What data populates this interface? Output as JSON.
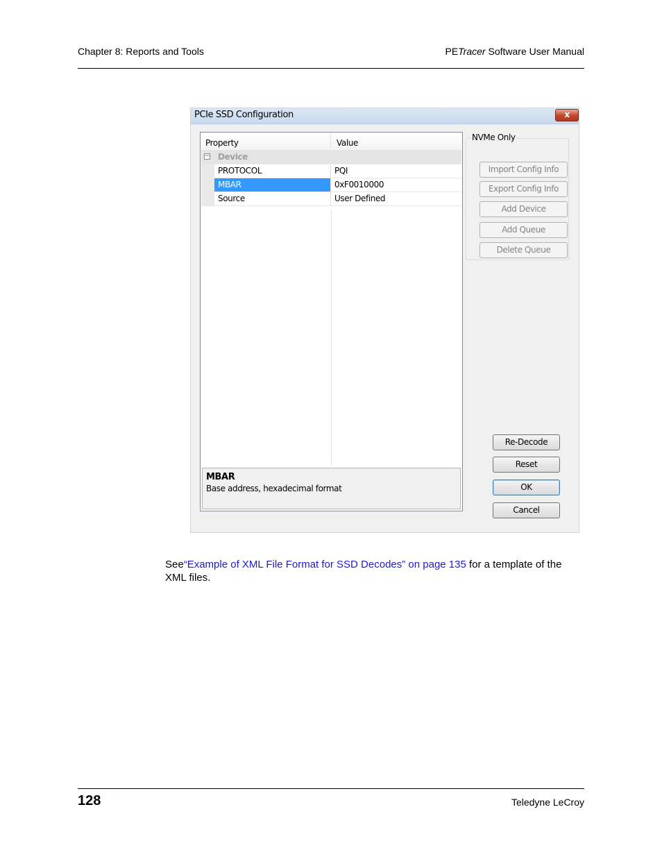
{
  "header": {
    "chapter": "Chapter 8: Reports and Tools",
    "manual_prefix": "PE",
    "manual_italic": "Tracer",
    "manual_suffix": " Software User Manual"
  },
  "dialog": {
    "title": "PCIe SSD Configuration",
    "close_glyph": "x",
    "grid": {
      "col_property": "Property",
      "col_value": "Value",
      "category": "Device",
      "expander_glyph": "−",
      "rows": [
        {
          "property": "PROTOCOL",
          "value": "PQI"
        },
        {
          "property": "MBAR",
          "value": "0xF0010000"
        },
        {
          "property": "Source",
          "value": "User Defined"
        }
      ],
      "selected_row": "MBAR"
    },
    "description": {
      "name": "MBAR",
      "text": "Base address, hexadecimal format"
    },
    "nvme_group": {
      "label": "NVMe Only",
      "buttons": {
        "import": "Import Config Info",
        "export": "Export Config Info",
        "add_device": "Add Device",
        "add_queue": "Add Queue",
        "delete_queue": "Delete Queue"
      }
    },
    "actions": {
      "redecode": "Re-Decode",
      "reset": "Reset",
      "ok": "OK",
      "cancel": "Cancel"
    }
  },
  "paragraph": {
    "see": "See",
    "link": "“Example of XML File Format for SSD Decodes” on page 135",
    "rest": " for a template of the XML files."
  },
  "footer": {
    "page_number": "128",
    "company": "Teledyne LeCroy"
  },
  "colors": {
    "link": "#1a1ad2",
    "selection": "#3399ff"
  }
}
